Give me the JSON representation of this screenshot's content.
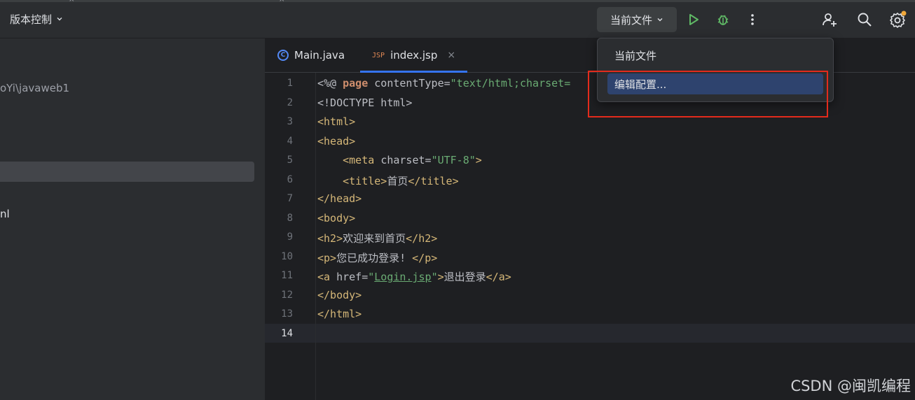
{
  "toolbar": {
    "vcs_label": "版本控制",
    "run_config_label": "当前文件",
    "icons": [
      "chevron-down-icon",
      "run-icon",
      "debug-icon",
      "more-icon",
      "add-user-icon",
      "search-icon",
      "settings-icon"
    ],
    "accent_colors": {
      "run": "#5fb865",
      "debug": "#5fb865",
      "notification_dot": "#f2a93b"
    }
  },
  "sidebar": {
    "path_fragment": "oYi\\javaweb1",
    "item_fragment": "nl"
  },
  "tabs": [
    {
      "label": "Main.java",
      "icon": "java-class-icon",
      "icon_glyph": "C",
      "active": false
    },
    {
      "label": "index.jsp",
      "icon": "jsp-file-icon",
      "icon_glyph": "JSP",
      "active": true,
      "close": "×"
    }
  ],
  "editor": {
    "current_line": 14,
    "line_numbers": [
      "1",
      "2",
      "3",
      "4",
      "5",
      "6",
      "7",
      "8",
      "9",
      "10",
      "11",
      "12",
      "13",
      "14"
    ],
    "lines": [
      [
        {
          "t": "<%@ ",
          "c": "text"
        },
        {
          "t": "page",
          "c": "kw"
        },
        {
          "t": " contentType=",
          "c": "text"
        },
        {
          "t": "\"text/html;charset=",
          "c": "str"
        }
      ],
      [
        {
          "t": "<!DOCTYPE html>",
          "c": "text"
        }
      ],
      [
        {
          "t": "<html>",
          "c": "tag"
        }
      ],
      [
        {
          "t": "<head>",
          "c": "tag"
        }
      ],
      [
        {
          "t": "    ",
          "c": "text"
        },
        {
          "t": "<meta ",
          "c": "tag"
        },
        {
          "t": "charset=",
          "c": "text"
        },
        {
          "t": "\"UTF-8\"",
          "c": "str"
        },
        {
          "t": ">",
          "c": "tag"
        }
      ],
      [
        {
          "t": "    ",
          "c": "text"
        },
        {
          "t": "<title>",
          "c": "tag"
        },
        {
          "t": "首页",
          "c": "text"
        },
        {
          "t": "</title>",
          "c": "tag"
        }
      ],
      [
        {
          "t": "</head>",
          "c": "tag"
        }
      ],
      [
        {
          "t": "<body>",
          "c": "tag"
        }
      ],
      [
        {
          "t": "<h2>",
          "c": "tag"
        },
        {
          "t": "欢迎来到首页",
          "c": "text"
        },
        {
          "t": "</h2>",
          "c": "tag"
        }
      ],
      [
        {
          "t": "<p>",
          "c": "tag"
        },
        {
          "t": "您已成功登录! ",
          "c": "text"
        },
        {
          "t": "</p>",
          "c": "tag"
        }
      ],
      [
        {
          "t": "<a ",
          "c": "tag"
        },
        {
          "t": "href=",
          "c": "text"
        },
        {
          "t": "\"",
          "c": "str"
        },
        {
          "t": "Login.jsp",
          "c": "link"
        },
        {
          "t": "\"",
          "c": "str"
        },
        {
          "t": ">",
          "c": "tag"
        },
        {
          "t": "退出登录",
          "c": "text"
        },
        {
          "t": "</a>",
          "c": "tag"
        }
      ],
      [
        {
          "t": "</body>",
          "c": "tag"
        }
      ],
      [
        {
          "t": "</html>",
          "c": "tag"
        }
      ],
      []
    ]
  },
  "popup": {
    "items": [
      {
        "label": "当前文件",
        "selected": false
      },
      {
        "label": "编辑配置...",
        "selected": true
      }
    ],
    "highlight_color": "#e32b1c"
  },
  "watermark": "CSDN @闽凯编程"
}
